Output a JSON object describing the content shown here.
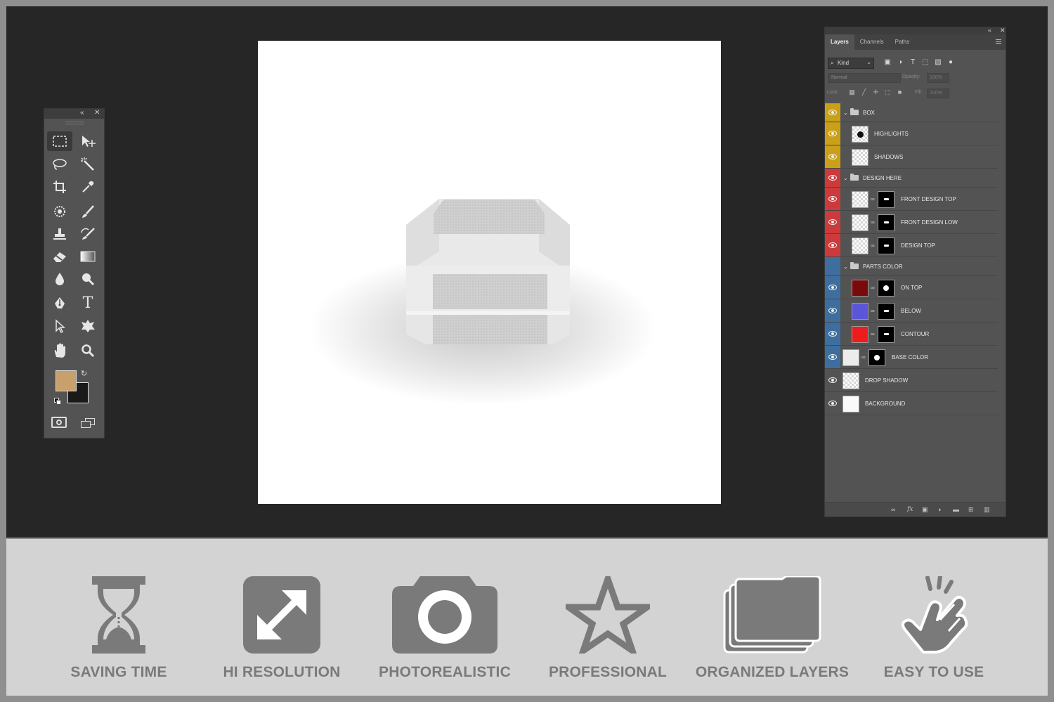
{
  "colors": {
    "foreground": "#c8a06c",
    "background": "#1a1a1a",
    "group_box": "#caa018",
    "group_design": "#cc3b3b",
    "group_parts": "#3d6e9e",
    "icon_gray": "#7a7a7a"
  },
  "toolbox": {
    "collapse_icon": "«",
    "close_icon": "✕",
    "text_tool_glyph": "T"
  },
  "layers_panel": {
    "collapse_icon": "«",
    "close_icon": "✕",
    "tabs": [
      {
        "label": "Layers",
        "active": true
      },
      {
        "label": "Channels",
        "active": false
      },
      {
        "label": "Paths",
        "active": false
      }
    ],
    "filter_kind": "Kind",
    "blend_mode": "Normal",
    "opacity_label": "Opacity:",
    "opacity_value": "100%",
    "lock_label": "Lock:",
    "fill_label": "Fill:",
    "fill_value": "100%",
    "layers": [
      {
        "name": "BOX",
        "group": true
      },
      {
        "name": "HIGHLIGHTS"
      },
      {
        "name": "SHADOWS"
      },
      {
        "name": "DESIGN HERE",
        "group": true
      },
      {
        "name": "FRONT DESIGN TOP"
      },
      {
        "name": "FRONT DESIGN LOW"
      },
      {
        "name": "DESIGN TOP"
      },
      {
        "name": "PARTS COLOR",
        "group": true
      },
      {
        "name": "ON TOP",
        "color": "#7a0a0a"
      },
      {
        "name": "BELOW",
        "color": "#5a55d9"
      },
      {
        "name": "CONTOUR",
        "color": "#ee1c1c"
      },
      {
        "name": "BASE COLOR"
      },
      {
        "name": "DROP SHADOW"
      },
      {
        "name": "BACKGROUND"
      }
    ]
  },
  "features": [
    {
      "label": "SAVING TIME",
      "icon": "hourglass-icon"
    },
    {
      "label": "HI RESOLUTION",
      "icon": "expand-arrows-icon"
    },
    {
      "label": "PHOTOREALISTIC",
      "icon": "camera-icon"
    },
    {
      "label": "PROFESSIONAL",
      "icon": "star-icon"
    },
    {
      "label": "ORGANIZED LAYERS",
      "icon": "folders-icon"
    },
    {
      "label": "EASY TO USE",
      "icon": "tap-hand-icon"
    }
  ]
}
